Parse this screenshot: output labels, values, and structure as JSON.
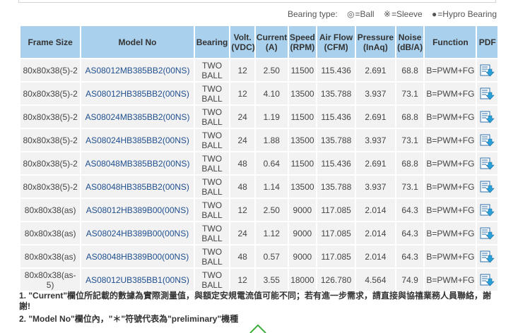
{
  "legend": {
    "label": "Bearing type:",
    "items": [
      {
        "symbol": "◎",
        "text": "=Ball"
      },
      {
        "symbol": "※",
        "text": "=Sleeve"
      },
      {
        "symbol": "●",
        "text": "=Hypro Bearing"
      }
    ]
  },
  "table": {
    "headers": [
      "Frame Size",
      "Model No",
      "Bearing",
      "Volt. (VDC)",
      "Current (A)",
      "Speed (RPM)",
      "Air Flow (CFM)",
      "Pressure (InAq)",
      "Noise (dB/A)",
      "Function",
      "PDF"
    ],
    "rows": [
      {
        "frame": "80x80x38(5)-2",
        "model": "AS08012MB385BB2(00NS)",
        "bearing": "TWO BALL",
        "volt": "12",
        "current": "2.50",
        "speed": "11500",
        "airflow": "115.436",
        "pressure": "2.691",
        "noise": "68.8",
        "function": "B=PWM+FG"
      },
      {
        "frame": "80x80x38(5)-2",
        "model": "AS08012HB385BB2(00NS)",
        "bearing": "TWO BALL",
        "volt": "12",
        "current": "4.10",
        "speed": "13500",
        "airflow": "135.788",
        "pressure": "3.937",
        "noise": "73.1",
        "function": "B=PWM+FG"
      },
      {
        "frame": "80x80x38(5)-2",
        "model": "AS08024MB385BB2(00NS)",
        "bearing": "TWO BALL",
        "volt": "24",
        "current": "1.19",
        "speed": "11500",
        "airflow": "115.436",
        "pressure": "2.691",
        "noise": "68.8",
        "function": "B=PWM+FG"
      },
      {
        "frame": "80x80x38(5)-2",
        "model": "AS08024HB385BB2(00NS)",
        "bearing": "TWO BALL",
        "volt": "24",
        "current": "1.88",
        "speed": "13500",
        "airflow": "135.788",
        "pressure": "3.937",
        "noise": "73.1",
        "function": "B=PWM+FG"
      },
      {
        "frame": "80x80x38(5)-2",
        "model": "AS08048MB385BB2(00NS)",
        "bearing": "TWO BALL",
        "volt": "48",
        "current": "0.64",
        "speed": "11500",
        "airflow": "115.436",
        "pressure": "2.691",
        "noise": "68.8",
        "function": "B=PWM+FG"
      },
      {
        "frame": "80x80x38(5)-2",
        "model": "AS08048HB385BB2(00NS)",
        "bearing": "TWO BALL",
        "volt": "48",
        "current": "1.14",
        "speed": "13500",
        "airflow": "135.788",
        "pressure": "3.937",
        "noise": "73.1",
        "function": "B=PWM+FG"
      },
      {
        "frame": "80x80x38(as)",
        "model": "AS08012HB389B00(00NS)",
        "bearing": "TWO BALL",
        "volt": "12",
        "current": "2.50",
        "speed": "9000",
        "airflow": "117.085",
        "pressure": "2.014",
        "noise": "64.3",
        "function": "B=PWM+FG"
      },
      {
        "frame": "80x80x38(as)",
        "model": "AS08024HB389B00(00NS)",
        "bearing": "TWO BALL",
        "volt": "24",
        "current": "1.12",
        "speed": "9000",
        "airflow": "117.085",
        "pressure": "2.014",
        "noise": "64.3",
        "function": "B=PWM+FG"
      },
      {
        "frame": "80x80x38(as)",
        "model": "AS08048HB389B00(00NS)",
        "bearing": "TWO BALL",
        "volt": "48",
        "current": "0.57",
        "speed": "9000",
        "airflow": "117.085",
        "pressure": "2.014",
        "noise": "64.3",
        "function": "B=PWM+FG"
      },
      {
        "frame": "80x80x38(as-5)",
        "model": "AS08012UB385BB1(00NS)",
        "bearing": "TWO BALL",
        "volt": "12",
        "current": "3.55",
        "speed": "18000",
        "airflow": "126.780",
        "pressure": "4.564",
        "noise": "74.9",
        "function": "B=PWM+FG"
      }
    ]
  },
  "notes": {
    "note1": "1. \"Current\"欄位所記載的數據為實際測量值，與額定安規電流值可能不同；若有進一步需求，請直接與協禧業務人員聯絡，謝謝!",
    "note2": "2. \"Model No\"欄位內，\"＊\"符號代表為\"preliminary\"機種"
  },
  "icons": {
    "pdf": "pdf-download-icon",
    "bottom": "green-arrow-icon"
  }
}
